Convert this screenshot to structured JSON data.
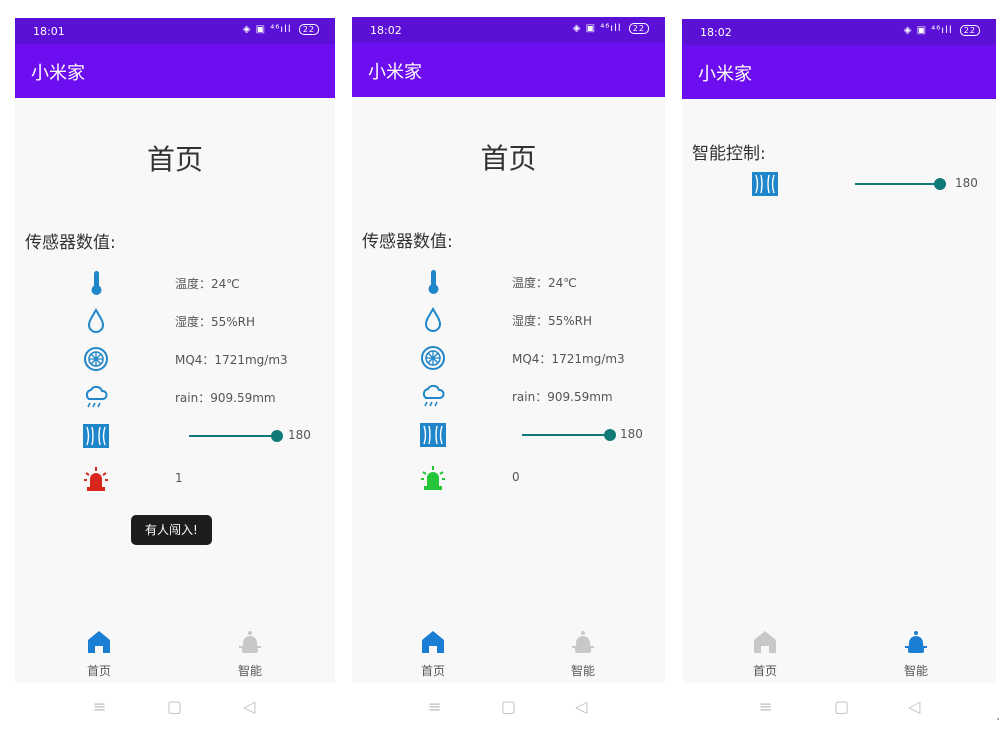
{
  "colors": {
    "statusbar": "#5b10d6",
    "appbar": "#6c0ef0",
    "accent": "#0f7a77",
    "alarm_on": "#d8261d",
    "alarm_off": "#25c53a",
    "nav_active": "#1a7fd4",
    "nav_inactive": "#c8c8c8"
  },
  "screens": [
    {
      "time": "18:01",
      "battery": "22",
      "app_title": "小米家",
      "page_title": "首页",
      "section_title": "传感器数值:",
      "sensors": [
        {
          "icon": "thermometer-icon",
          "label": "温度：24℃"
        },
        {
          "icon": "water-drop-icon",
          "label": "湿度：55%RH"
        },
        {
          "icon": "gas-sensor-icon",
          "label": "MQ4：1721mg/m3"
        },
        {
          "icon": "rain-cloud-icon",
          "label": "rain：909.59mm"
        }
      ],
      "curtain_slider_value": "180",
      "alarm_state": "1",
      "toast": "有人闯入!",
      "nav": {
        "home": "首页",
        "smart": "智能"
      },
      "active_nav": "home"
    },
    {
      "time": "18:02",
      "battery": "22",
      "app_title": "小米家",
      "page_title": "首页",
      "section_title": "传感器数值:",
      "sensors": [
        {
          "icon": "thermometer-icon",
          "label": "温度：24℃"
        },
        {
          "icon": "water-drop-icon",
          "label": "湿度：55%RH"
        },
        {
          "icon": "gas-sensor-icon",
          "label": "MQ4：1721mg/m3"
        },
        {
          "icon": "rain-cloud-icon",
          "label": "rain：909.59mm"
        }
      ],
      "curtain_slider_value": "180",
      "alarm_state": "0",
      "nav": {
        "home": "首页",
        "smart": "智能"
      },
      "active_nav": "home"
    },
    {
      "time": "18:02",
      "battery": "22",
      "app_title": "小米家",
      "section_title": "智能控制:",
      "curtain_slider_value": "180",
      "nav": {
        "home": "首页",
        "smart": "智能"
      },
      "active_nav": "smart"
    }
  ],
  "edge_glyph": "·"
}
